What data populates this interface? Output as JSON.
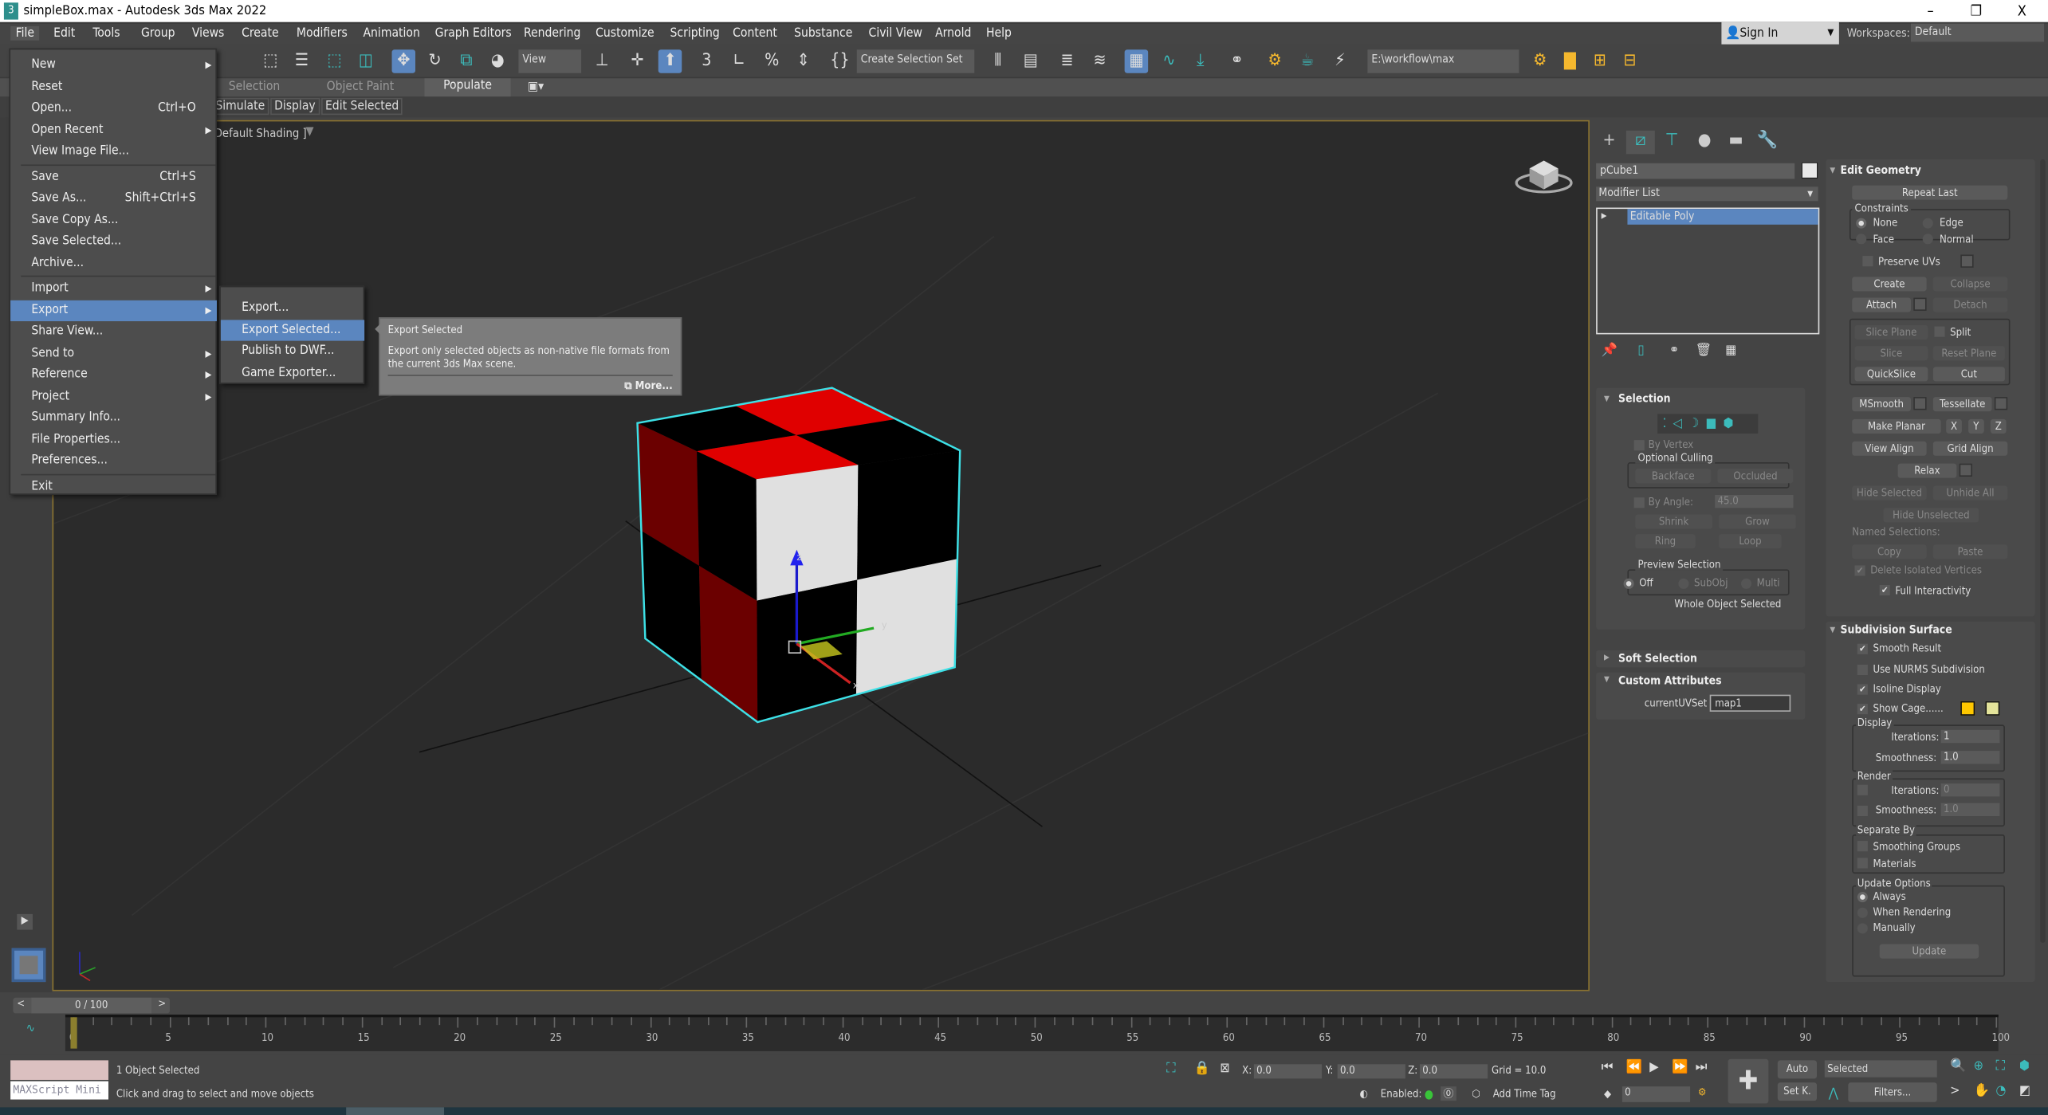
{
  "window": {
    "title": "simpleBox.max - Autodesk 3ds Max 2022",
    "app_icon": "3",
    "minimize": "–",
    "maximize": "❐",
    "close": "X"
  },
  "menubar": [
    "File",
    "Edit",
    "Tools",
    "Group",
    "Views",
    "Create",
    "Modifiers",
    "Animation",
    "Graph Editors",
    "Rendering",
    "Customize",
    "Scripting",
    "Content",
    "Substance",
    "Civil View",
    "Arnold",
    "Help"
  ],
  "account": {
    "sign_in": "Sign In",
    "workspaces_label": "Workspaces:",
    "workspace": "Default"
  },
  "toolbar": {
    "view_dropdown": "View",
    "selection_set": "Create Selection Set",
    "project_path": "E:\\workflow\\max"
  },
  "ribbon": {
    "tabs": [
      "Selection",
      "Object Paint",
      "Populate"
    ],
    "active_tab": "Populate",
    "subtabs": [
      "Simulate",
      "Display",
      "Edit Selected"
    ]
  },
  "viewport": {
    "label": "Default Shading ]",
    "axis_labels": {
      "x": "x",
      "y": "y",
      "z": "z"
    }
  },
  "file_menu": {
    "items": [
      {
        "label": "New",
        "shortcut": "",
        "submenu": true
      },
      {
        "label": "Reset",
        "shortcut": "",
        "submenu": false
      },
      {
        "label": "Open...",
        "shortcut": "Ctrl+O",
        "submenu": false
      },
      {
        "label": "Open Recent",
        "shortcut": "",
        "submenu": true
      },
      {
        "label": "View Image File...",
        "shortcut": "",
        "submenu": false
      },
      {
        "label": "Save",
        "shortcut": "Ctrl+S",
        "submenu": false
      },
      {
        "label": "Save As...",
        "shortcut": "Shift+Ctrl+S",
        "submenu": false
      },
      {
        "label": "Save Copy As...",
        "shortcut": "",
        "submenu": false
      },
      {
        "label": "Save Selected...",
        "shortcut": "",
        "submenu": false
      },
      {
        "label": "Archive...",
        "shortcut": "",
        "submenu": false
      },
      {
        "label": "Import",
        "shortcut": "",
        "submenu": true
      },
      {
        "label": "Export",
        "shortcut": "",
        "submenu": true,
        "highlighted": true
      },
      {
        "label": "Share View...",
        "shortcut": "",
        "submenu": false
      },
      {
        "label": "Send to",
        "shortcut": "",
        "submenu": true
      },
      {
        "label": "Reference",
        "shortcut": "",
        "submenu": true
      },
      {
        "label": "Project",
        "shortcut": "",
        "submenu": true
      },
      {
        "label": "Summary Info...",
        "shortcut": "",
        "submenu": false
      },
      {
        "label": "File Properties...",
        "shortcut": "",
        "submenu": false
      },
      {
        "label": "Preferences...",
        "shortcut": "",
        "submenu": false
      },
      {
        "label": "Exit",
        "shortcut": "",
        "submenu": false
      }
    ]
  },
  "export_submenu": {
    "items": [
      {
        "label": "Export..."
      },
      {
        "label": "Export Selected...",
        "highlighted": true
      },
      {
        "label": "Publish to DWF..."
      },
      {
        "label": "Game Exporter..."
      }
    ]
  },
  "tooltip": {
    "title": "Export Selected",
    "body": "Export only selected objects as non-native file formats from the current 3ds Max scene.",
    "more": "More..."
  },
  "command_panel": {
    "object_name": "pCube1",
    "object_color": "#e8e8e8",
    "modifier_list": "Modifier List",
    "stack": [
      "Editable Poly"
    ],
    "selection": {
      "title": "Selection",
      "by_vertex": "By Vertex",
      "optional_culling": "Optional Culling",
      "backface": "Backface",
      "occluded": "Occluded",
      "by_angle": "By Angle:",
      "angle": "45.0",
      "shrink": "Shrink",
      "grow": "Grow",
      "ring": "Ring",
      "loop": "Loop",
      "preview_selection": "Preview Selection",
      "off": "Off",
      "subobj": "SubObj",
      "multi": "Multi",
      "status": "Whole Object Selected"
    },
    "soft_selection": "Soft Selection",
    "custom_attributes": {
      "title": "Custom Attributes",
      "uvset_label": "currentUVSet",
      "uvset_value": "map1"
    },
    "edit_geometry": {
      "title": "Edit Geometry",
      "repeat_last": "Repeat Last",
      "constraints": "Constraints",
      "none": "None",
      "edge": "Edge",
      "face": "Face",
      "normal": "Normal",
      "preserve_uvs": "Preserve UVs",
      "create": "Create",
      "collapse": "Collapse",
      "attach": "Attach",
      "detach": "Detach",
      "slice_plane": "Slice Plane",
      "split": "Split",
      "slice": "Slice",
      "reset_plane": "Reset Plane",
      "quickslice": "QuickSlice",
      "cut": "Cut",
      "msmooth": "MSmooth",
      "tessellate": "Tessellate",
      "make_planar": "Make Planar",
      "x": "X",
      "y": "Y",
      "z": "Z",
      "view_align": "View Align",
      "grid_align": "Grid Align",
      "relax": "Relax",
      "hide_selected": "Hide Selected",
      "unhide_all": "Unhide All",
      "hide_unselected": "Hide Unselected",
      "named_selections": "Named Selections:",
      "copy": "Copy",
      "paste": "Paste",
      "delete_isolated": "Delete Isolated Vertices",
      "full_interactivity": "Full Interactivity"
    },
    "subdivision": {
      "title": "Subdivision Surface",
      "smooth_result": "Smooth Result",
      "use_nurms": "Use NURMS Subdivision",
      "isoline": "Isoline Display",
      "show_cage": "Show Cage......",
      "cage_color1": "#ffc800",
      "cage_color2": "#e4e49a",
      "display": "Display",
      "iterations": "Iterations:",
      "display_iterations": "1",
      "smoothness": "Smoothness:",
      "display_smoothness": "1.0",
      "render": "Render",
      "render_iterations": "0",
      "render_smoothness": "1.0",
      "separate_by": "Separate By",
      "smoothing_groups": "Smoothing Groups",
      "materials": "Materials",
      "update_options": "Update Options",
      "always": "Always",
      "when_rendering": "When Rendering",
      "manually": "Manually",
      "update": "Update"
    }
  },
  "timeline": {
    "frame": "0 / 100",
    "ticks": [
      "0",
      "5",
      "10",
      "15",
      "20",
      "25",
      "30",
      "35",
      "40",
      "45",
      "50",
      "55",
      "60",
      "65",
      "70",
      "75",
      "80",
      "85",
      "90",
      "95",
      "100"
    ]
  },
  "status": {
    "maxscript": "MAXScript Mini",
    "selected": "1 Object Selected",
    "prompt": "Click and drag to select and move objects",
    "x_label": "X:",
    "x": "0.0",
    "y_label": "Y:",
    "y": "0.0",
    "z_label": "Z:",
    "z": "0.0",
    "grid": "Grid = 10.0",
    "enabled": "Enabled:",
    "add_time_tag": "Add Time Tag",
    "current_frame": "0",
    "auto": "Auto",
    "set_key": "Set K.",
    "key_filter": "Selected",
    "filters": "Filters..."
  }
}
